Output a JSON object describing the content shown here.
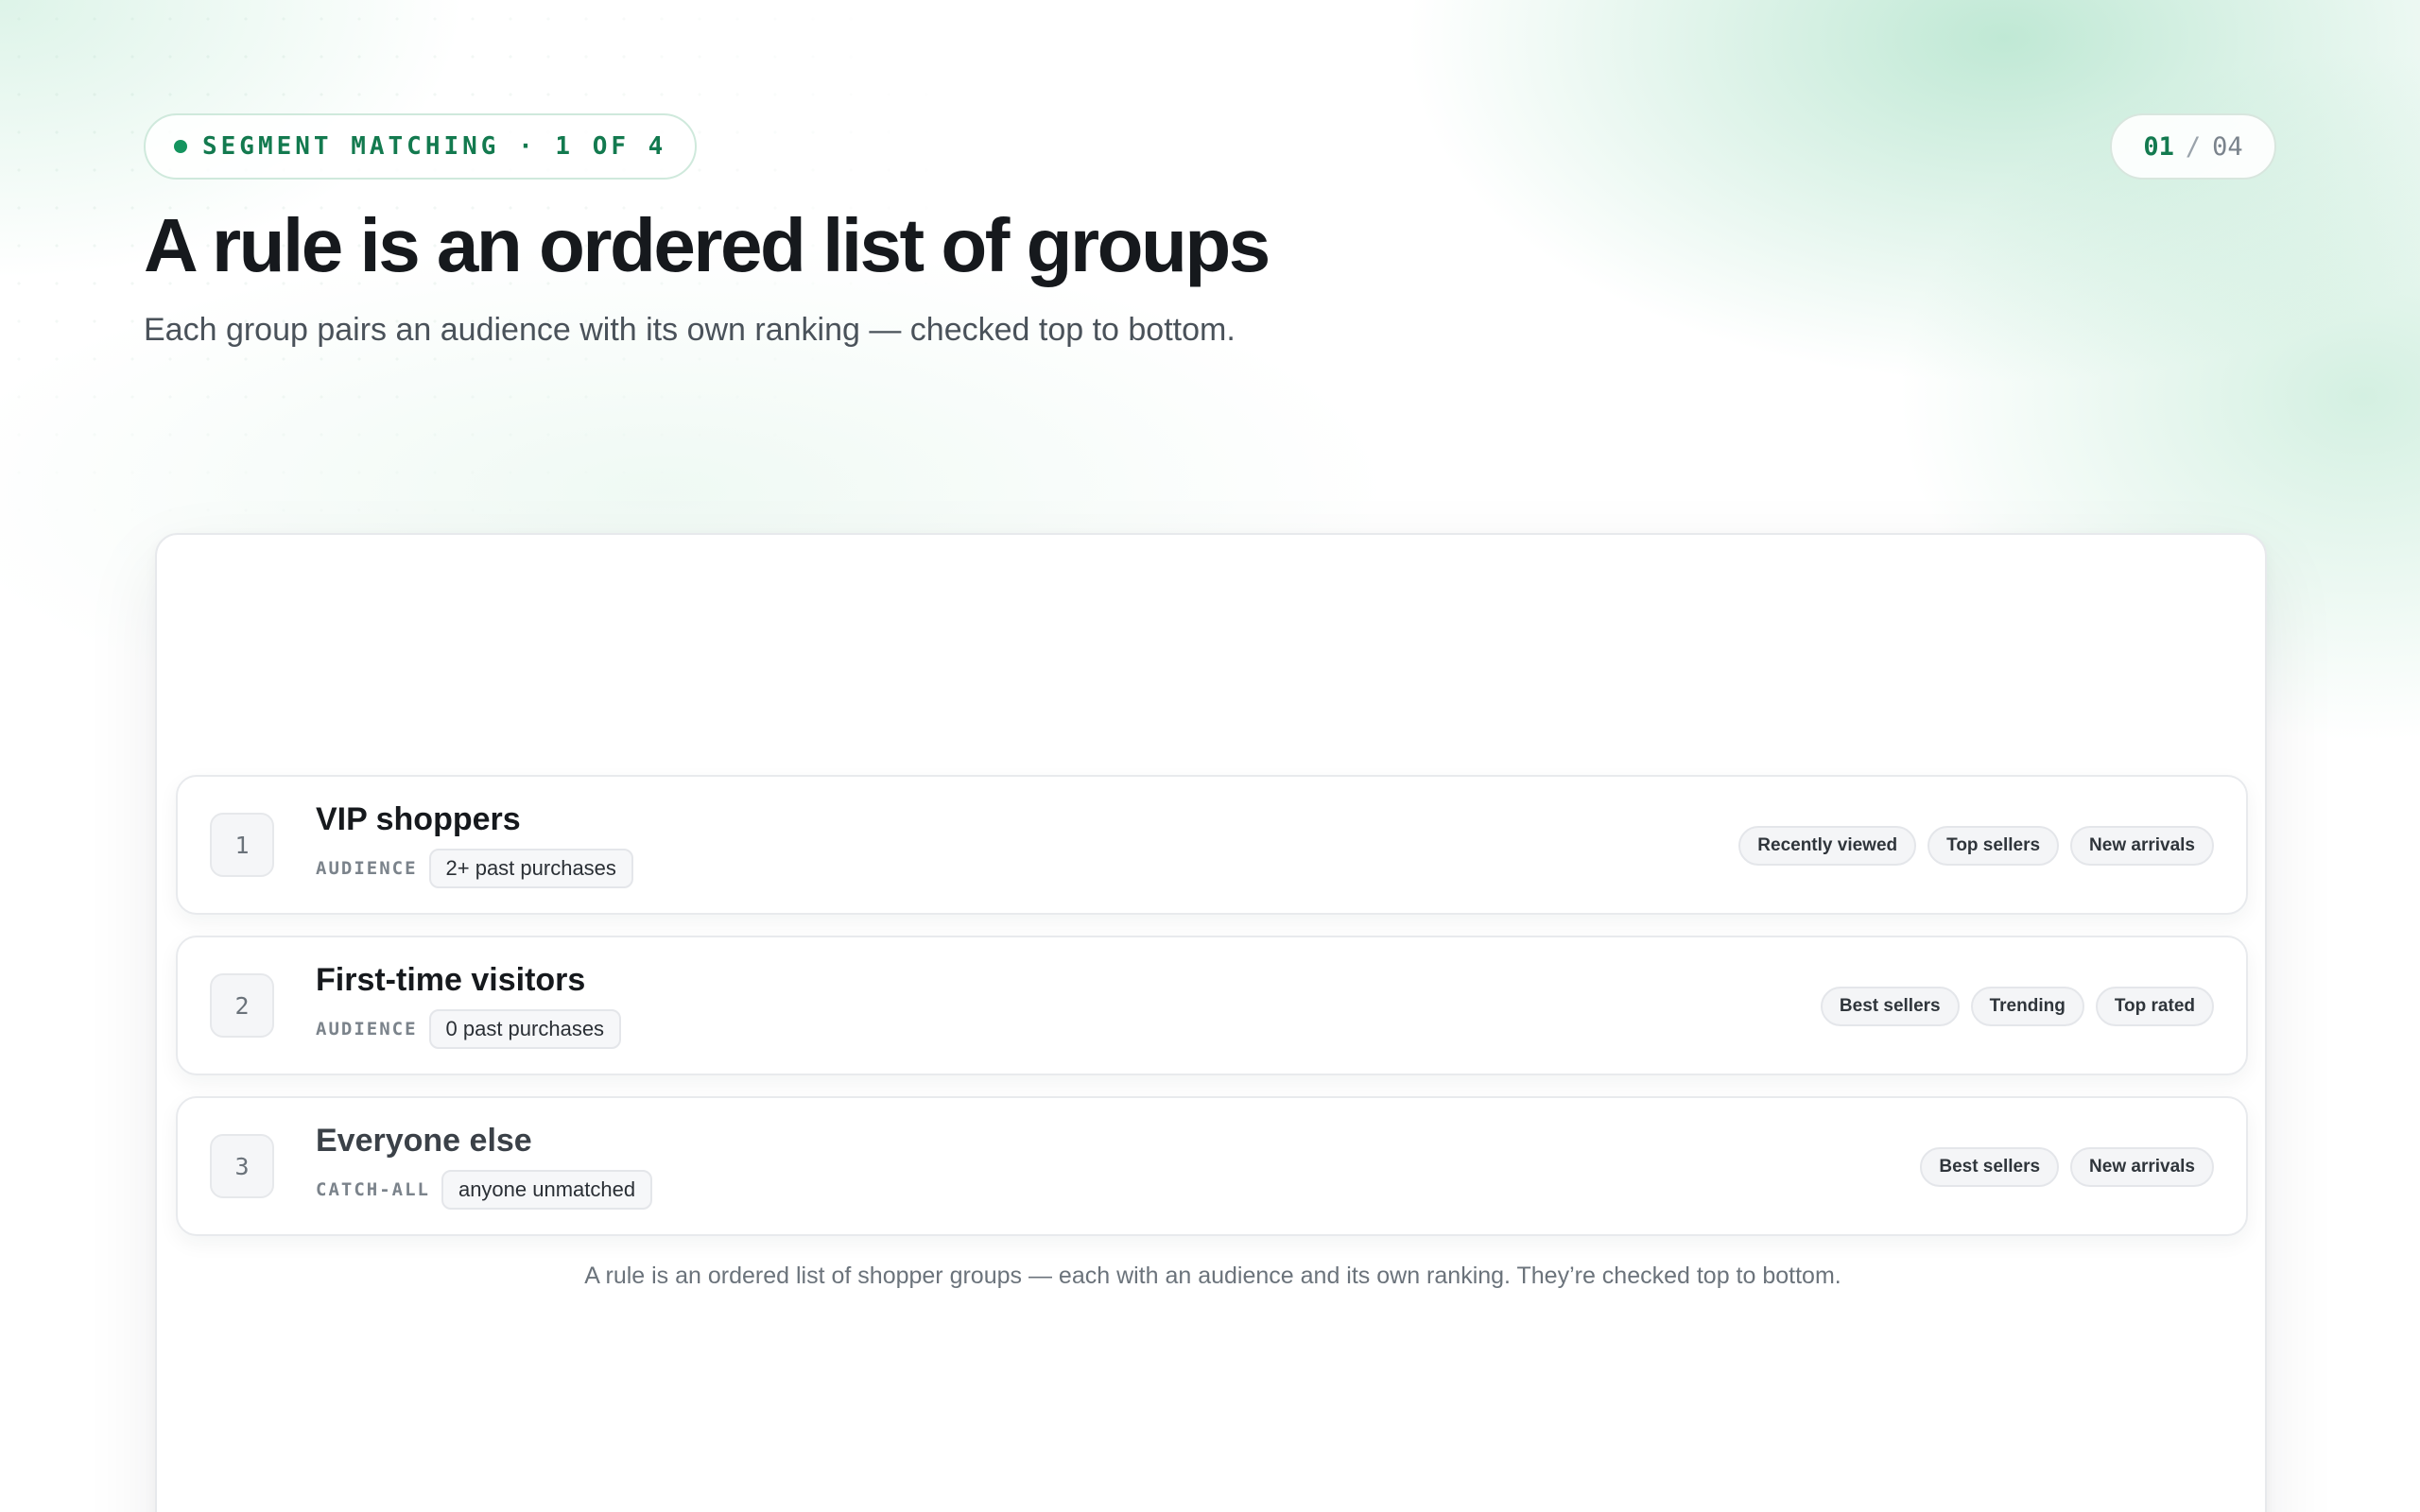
{
  "eyebrow": {
    "label": "SEGMENT MATCHING · 1 OF 4",
    "accent": "#14945e"
  },
  "pager": {
    "current": "01",
    "separator": "/",
    "total": "04"
  },
  "header": {
    "title": "A rule is an ordered list of groups",
    "subtitle": "Each group pairs an audience with its own ranking — checked top to bottom."
  },
  "groups": [
    {
      "number": "1",
      "name": "VIP shoppers",
      "meta_label": "AUDIENCE",
      "meta_value": "2+ past purchases",
      "rankings": [
        "Recently viewed",
        "Top sellers",
        "New arrivals"
      ]
    },
    {
      "number": "2",
      "name": "First-time visitors",
      "meta_label": "AUDIENCE",
      "meta_value": "0 past purchases",
      "rankings": [
        "Best sellers",
        "Trending",
        "Top rated"
      ]
    },
    {
      "number": "3",
      "name": "Everyone else",
      "meta_label": "CATCH-ALL",
      "meta_value": "anyone unmatched",
      "rankings": [
        "Best sellers",
        "New arrivals"
      ]
    }
  ],
  "caption": "A rule is an ordered list of shopper groups — each with an audience and its own ranking. They’re checked top to bottom."
}
